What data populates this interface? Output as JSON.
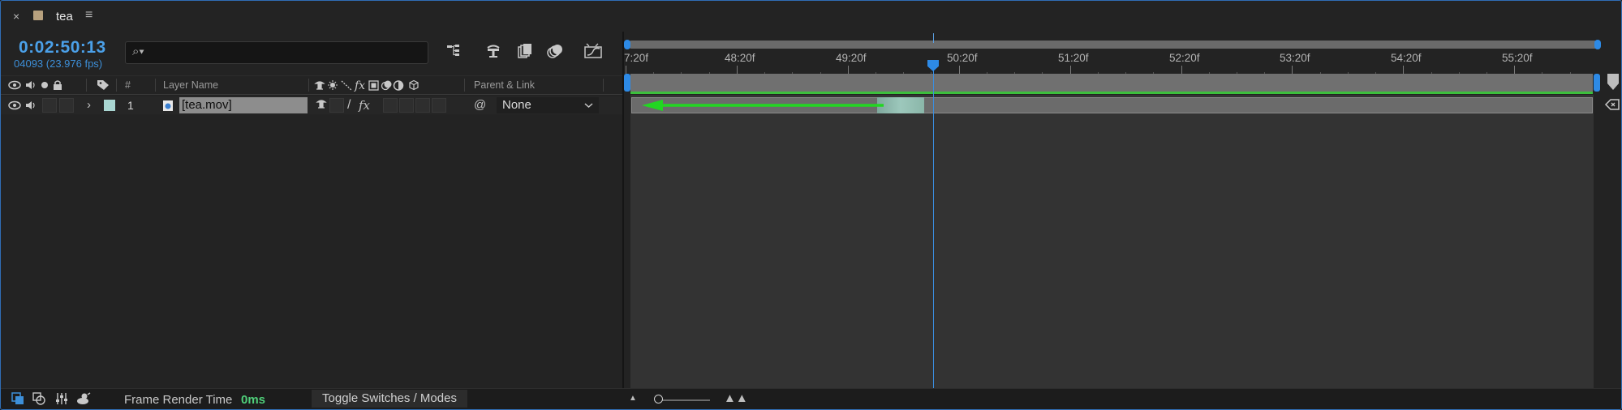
{
  "tab": {
    "close": "×",
    "title": "tea",
    "menu": "≡",
    "swatch_color": "#b7a17e"
  },
  "time": {
    "timecode": "0:02:50:13",
    "frames_fps": "04093 (23.976 fps)"
  },
  "search": {
    "icon": "search-icon",
    "glyph": "⌕▾",
    "value": ""
  },
  "tools": [
    "composition-flowchart-icon",
    "draft-3d-icon",
    "frame-blending-icon",
    "motion-blur-icon",
    "graph-editor-icon"
  ],
  "headers": {
    "av_icons": "👁 🔊 ● 🔒",
    "label_icon": "tag-icon",
    "number": "#",
    "layer_name": "Layer Name",
    "switches": "⚲ ☼ ⟍ fx ▣ ◐ ◑ ⬡",
    "parent_link": "Parent & Link"
  },
  "layer": {
    "expand": "›",
    "number": "1",
    "name": "[tea.mov]",
    "label_color": "#a9d6d2",
    "parent": "None",
    "quality_glyph": "/",
    "fx_glyph": "fx",
    "pickwhip_glyph": "@"
  },
  "ruler": {
    "labels": [
      "7:20f",
      "48:20f",
      "49:20f",
      "50:20f",
      "51:20f",
      "52:20f",
      "53:20f",
      "54:20f",
      "55:20f"
    ]
  },
  "playhead": {
    "position_label": "50:20f"
  },
  "bottom": {
    "frame_render_label": "Frame Render Time",
    "frame_render_value": "0ms",
    "toggle_label": "Toggle Switches / Modes",
    "icons": [
      "comp-mini-flowchart-icon",
      "layer-switches-icon",
      "transfer-controls-icon",
      "in-out-duration-icon"
    ]
  },
  "colors": {
    "accent_blue": "#2d8ae6",
    "work_area_green": "#3cbf3c",
    "render_time_green": "#4fcf7a"
  }
}
